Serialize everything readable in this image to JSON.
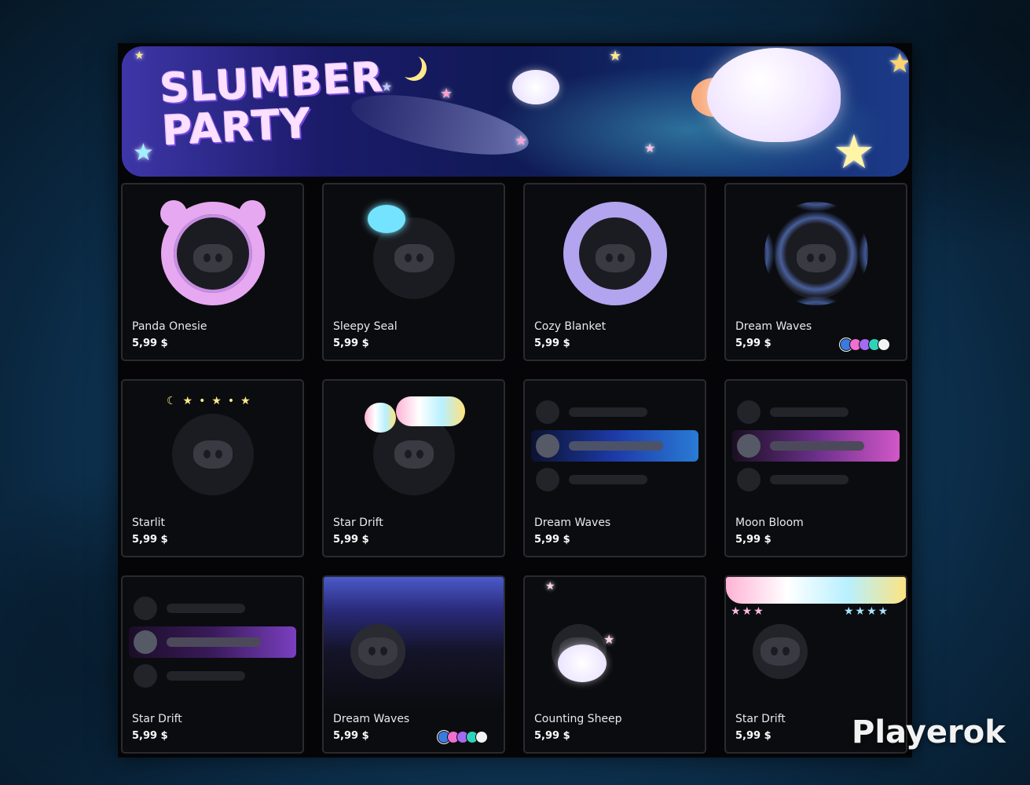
{
  "banner": {
    "title_line1": "SLUMBER",
    "title_line2": "PARTY"
  },
  "items": [
    {
      "name": "Panda Onesie",
      "price": "5,99 $",
      "kind": "decoration",
      "style": "panda"
    },
    {
      "name": "Sleepy Seal",
      "price": "5,99 $",
      "kind": "decoration",
      "style": "seal"
    },
    {
      "name": "Cozy Blanket",
      "price": "5,99 $",
      "kind": "decoration",
      "style": "blanket"
    },
    {
      "name": "Dream Waves",
      "price": "5,99 $",
      "kind": "decoration",
      "style": "waves",
      "swatches": [
        "#3a7be0",
        "#f26fd0",
        "#a46af3",
        "#2ed3b7",
        "#f2f2f2"
      ]
    },
    {
      "name": "Starlit",
      "price": "5,99 $",
      "kind": "decoration",
      "style": "starlit"
    },
    {
      "name": "Star Drift",
      "price": "5,99 $",
      "kind": "decoration",
      "style": "clouds"
    },
    {
      "name": "Dream Waves",
      "price": "5,99 $",
      "kind": "nameplate",
      "style": "blue"
    },
    {
      "name": "Moon Bloom",
      "price": "5,99 $",
      "kind": "nameplate",
      "style": "pink"
    },
    {
      "name": "Star Drift",
      "price": "5,99 $",
      "kind": "nameplate",
      "style": "purple"
    },
    {
      "name": "Dream Waves",
      "price": "5,99 $",
      "kind": "profile-effect",
      "style": "aurora",
      "swatches": [
        "#3a7be0",
        "#f26fd0",
        "#a46af3",
        "#2ed3b7",
        "#f2f2f2"
      ]
    },
    {
      "name": "Counting Sheep",
      "price": "5,99 $",
      "kind": "profile-effect",
      "style": "sheep"
    },
    {
      "name": "Star Drift",
      "price": "5,99 $",
      "kind": "profile-effect",
      "style": "rainbow"
    }
  ],
  "watermark": "Playerok"
}
